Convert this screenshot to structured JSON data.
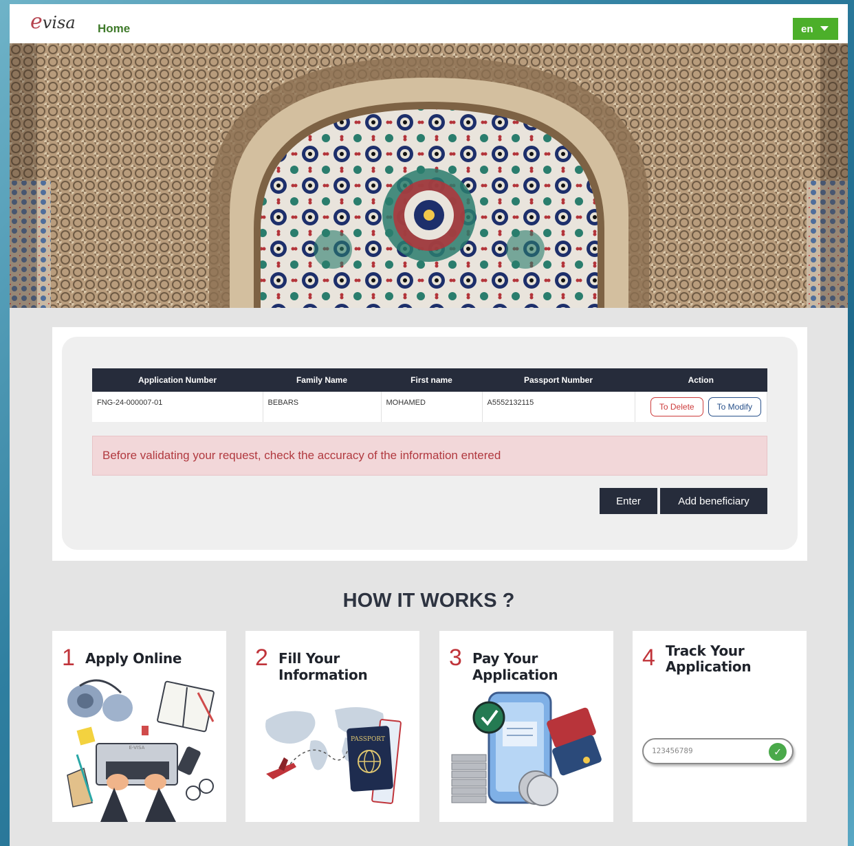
{
  "header": {
    "logo_text": "visa",
    "logo_letter": "e",
    "home_label": "Home",
    "language": "en"
  },
  "table": {
    "columns": [
      "Application Number",
      "Family Name",
      "First name",
      "Passport Number",
      "Action"
    ],
    "rows": [
      {
        "application_number": "FNG-24-000007-01",
        "family_name": "BEBARS",
        "first_name": "MOHAMED",
        "passport_number": "A5552132115",
        "delete_label": "To Delete",
        "modify_label": "To Modify"
      }
    ]
  },
  "alert": {
    "message": "Before validating your request, check the accuracy of the information entered"
  },
  "actions": {
    "enter_label": "Enter",
    "add_beneficiary_label": "Add beneficiary"
  },
  "how_it_works": {
    "title": "HOW IT WORKS ?",
    "steps": [
      {
        "number": "1",
        "label": "Apply Online"
      },
      {
        "number": "2",
        "label": "Fill Your Information"
      },
      {
        "number": "3",
        "label": "Pay Your Application"
      },
      {
        "number": "4",
        "label_line1": "Track Your",
        "label_line2": "Application",
        "input_value": "123456789"
      }
    ]
  },
  "illustration_text": {
    "passport": "PASSPORT",
    "laptop": "E-VISA"
  },
  "colors": {
    "accent_green": "#4caf2a",
    "home_green": "#3f7a2a",
    "dark_navy": "#262c3b",
    "alert_bg": "#f2d7d9",
    "alert_text": "#b1393f",
    "step_number_red": "#c0343a"
  }
}
